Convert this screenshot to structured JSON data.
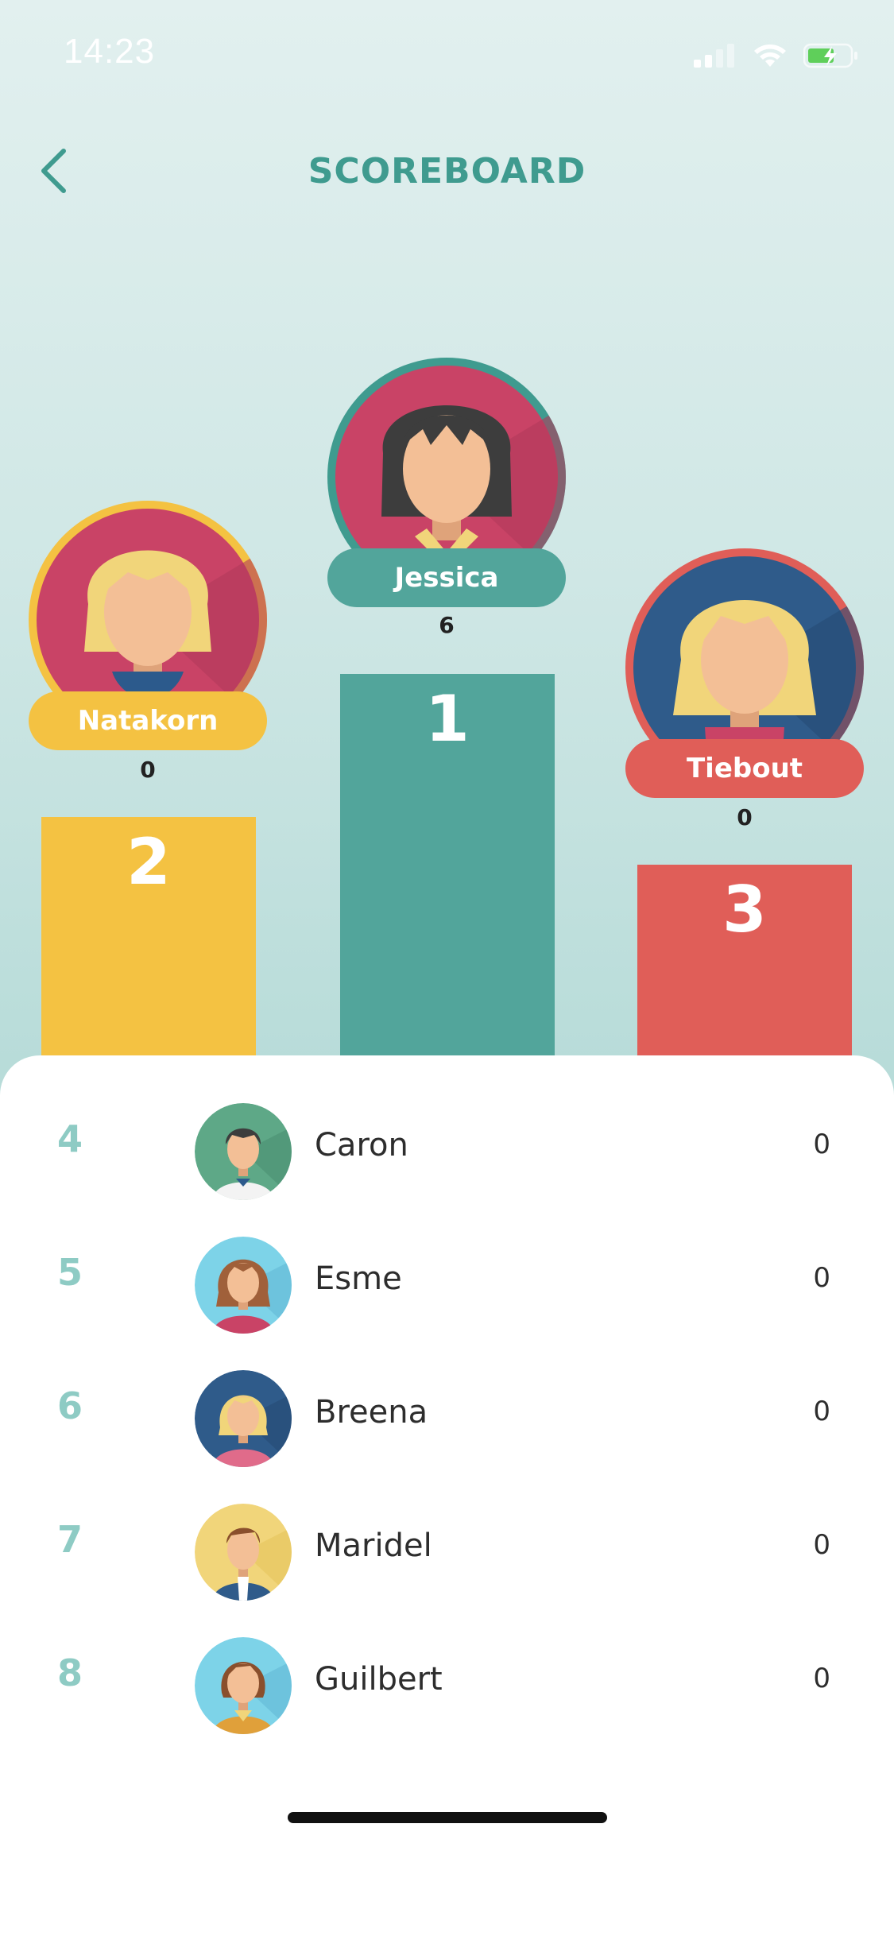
{
  "status_bar": {
    "time": "14:23"
  },
  "header": {
    "title": "SCOREBOARD"
  },
  "colors": {
    "accent": "#3f9b8f",
    "first": "#52a59b",
    "second": "#f4c242",
    "third": "#e05e58"
  },
  "podium": {
    "first": {
      "name": "Jessica",
      "score": "6",
      "rank": "1"
    },
    "second": {
      "name": "Natakorn",
      "score": "0",
      "rank": "2"
    },
    "third": {
      "name": "Tiebout",
      "score": "0",
      "rank": "3"
    }
  },
  "list": [
    {
      "rank": "4",
      "name": "Caron",
      "score": "0",
      "icon": "avatar-man-dark-hair"
    },
    {
      "rank": "5",
      "name": "Esme",
      "score": "0",
      "icon": "avatar-woman-brown-hair"
    },
    {
      "rank": "6",
      "name": "Breena",
      "score": "0",
      "icon": "avatar-woman-blonde"
    },
    {
      "rank": "7",
      "name": "Maridel",
      "score": "0",
      "icon": "avatar-man-suit"
    },
    {
      "rank": "8",
      "name": "Guilbert",
      "score": "0",
      "icon": "avatar-woman-bob"
    }
  ]
}
